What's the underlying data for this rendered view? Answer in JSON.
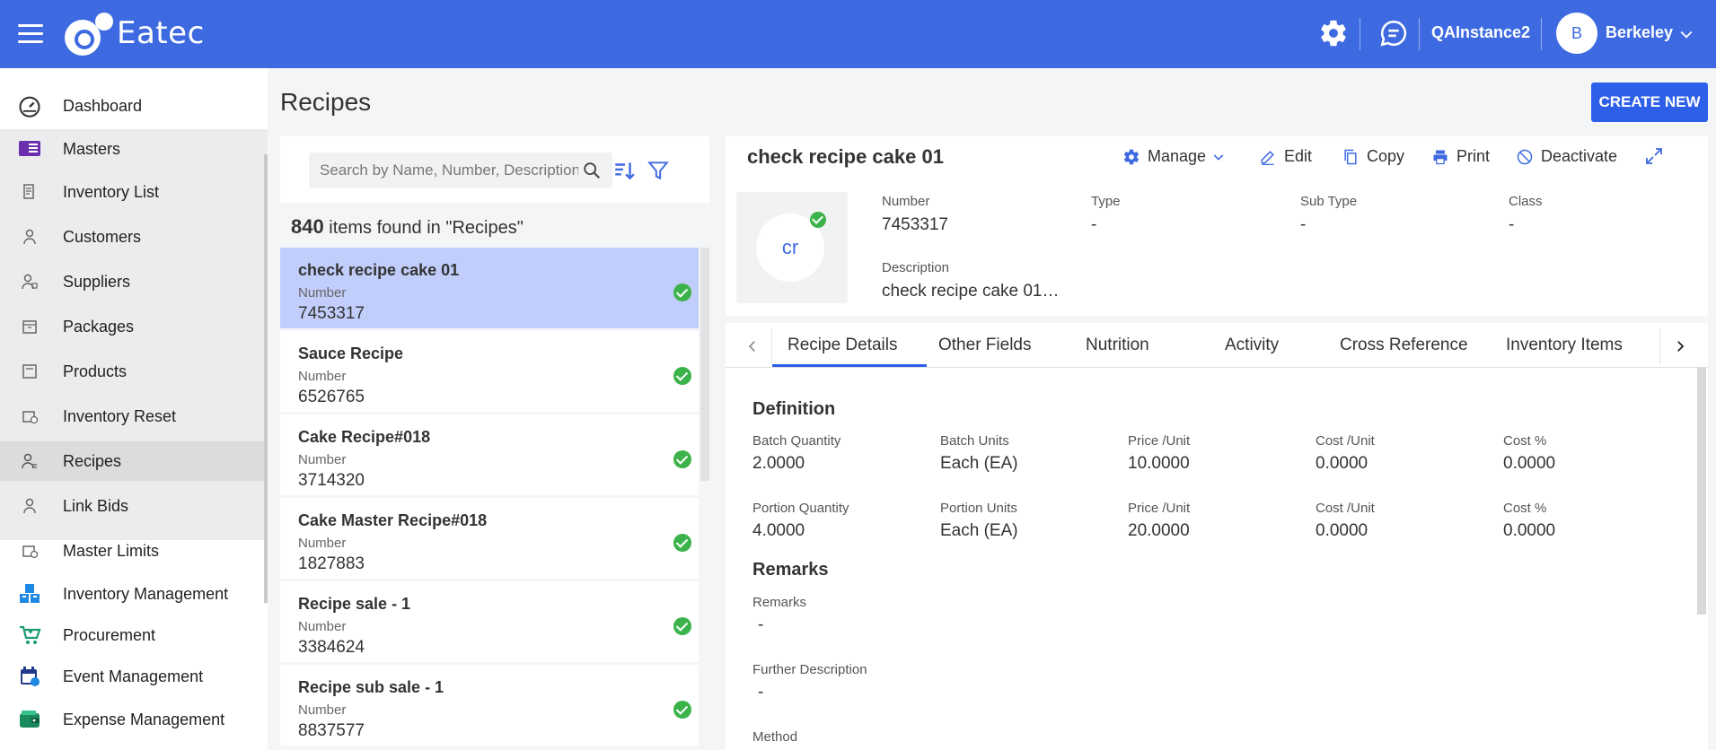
{
  "header": {
    "logo_text": "Eatec",
    "instance": "QAInstance2",
    "user_initial": "B",
    "user_name": "Berkeley",
    "brand_color": "#3e6ae1"
  },
  "sidebar": {
    "items": [
      {
        "label": "Dashboard",
        "icon": "dashboard-icon"
      },
      {
        "label": "Masters",
        "icon": "masters-icon"
      },
      {
        "label": "Inventory List",
        "icon": "inventory-list-icon"
      },
      {
        "label": "Customers",
        "icon": "customers-icon"
      },
      {
        "label": "Suppliers",
        "icon": "suppliers-icon"
      },
      {
        "label": "Packages",
        "icon": "packages-icon"
      },
      {
        "label": "Products",
        "icon": "products-icon"
      },
      {
        "label": "Inventory Reset",
        "icon": "inventory-reset-icon"
      },
      {
        "label": "Recipes",
        "icon": "recipes-icon",
        "active": true
      },
      {
        "label": "Link Bids",
        "icon": "link-bids-icon"
      },
      {
        "label": "Master Limits",
        "icon": "master-limits-icon"
      },
      {
        "label": "Inventory Management",
        "icon": "inventory-management-icon"
      },
      {
        "label": "Procurement",
        "icon": "procurement-icon"
      },
      {
        "label": "Event Management",
        "icon": "event-management-icon"
      },
      {
        "label": "Expense Management",
        "icon": "expense-management-icon"
      }
    ]
  },
  "page": {
    "title": "Recipes",
    "create_label": "CREATE NEW"
  },
  "search": {
    "placeholder": "Search by Name, Number, Description"
  },
  "results": {
    "count": "840",
    "suffix": " items found in \"Recipes\""
  },
  "list": {
    "number_label": "Number",
    "items": [
      {
        "name": "check recipe cake 01",
        "number": "7453317",
        "selected": true
      },
      {
        "name": "Sauce Recipe",
        "number": "6526765"
      },
      {
        "name": "Cake Recipe#018",
        "number": "3714320"
      },
      {
        "name": "Cake Master Recipe#018",
        "number": "1827883"
      },
      {
        "name": "Recipe sale - 1",
        "number": "3384624"
      },
      {
        "name": "Recipe sub sale - 1",
        "number": "8837577"
      }
    ]
  },
  "detail": {
    "title": "check recipe cake 01",
    "actions": {
      "manage": "Manage",
      "edit": "Edit",
      "copy": "Copy",
      "print": "Print",
      "deactivate": "Deactivate"
    },
    "thumb_initials": "cr",
    "fields": {
      "number_label": "Number",
      "number": "7453317",
      "type_label": "Type",
      "type": "-",
      "subtype_label": "Sub Type",
      "subtype": "-",
      "class_label": "Class",
      "class": "-",
      "description_label": "Description",
      "description": "check recipe cake 01…"
    }
  },
  "tabs": [
    "Recipe Details",
    "Other Fields",
    "Nutrition",
    "Activity",
    "Cross Reference",
    "Inventory Items"
  ],
  "definition": {
    "title": "Definition",
    "row1": [
      {
        "label": "Batch Quantity",
        "value": "2.0000"
      },
      {
        "label": "Batch Units",
        "value": "Each (EA)"
      },
      {
        "label": "Price /Unit",
        "value": "10.0000"
      },
      {
        "label": "Cost /Unit",
        "value": "0.0000"
      },
      {
        "label": "Cost %",
        "value": "0.0000"
      }
    ],
    "row2": [
      {
        "label": "Portion Quantity",
        "value": "4.0000"
      },
      {
        "label": "Portion Units",
        "value": "Each (EA)"
      },
      {
        "label": "Price /Unit",
        "value": "20.0000"
      },
      {
        "label": "Cost /Unit",
        "value": "0.0000"
      },
      {
        "label": "Cost %",
        "value": "0.0000"
      }
    ]
  },
  "remarks": {
    "title": "Remarks",
    "remarks_label": "Remarks",
    "remarks_value": "-",
    "further_label": "Further Description",
    "further_value": "-",
    "method_label": "Method"
  }
}
